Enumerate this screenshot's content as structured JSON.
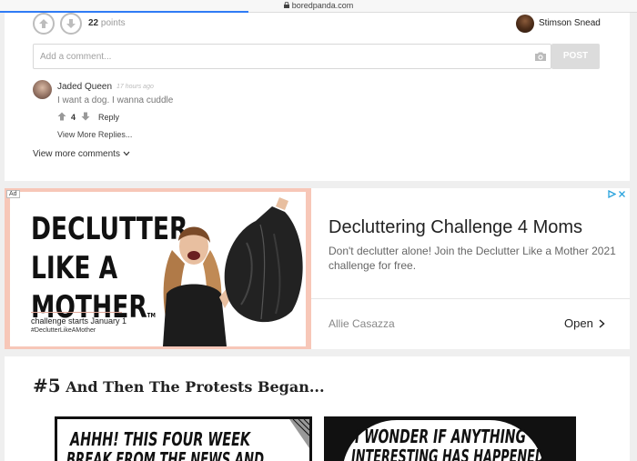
{
  "browser": {
    "url": "boredpanda.com",
    "progress": 0.39
  },
  "post_footer": {
    "points_value": "22",
    "points_label": "points",
    "author_name": "Stimson Snead"
  },
  "comment_form": {
    "placeholder": "Add a comment...",
    "post_label": "POST"
  },
  "comment": {
    "author": "Jaded Queen",
    "time": "17 hours ago",
    "text": "I want a dog. I wanna cuddle",
    "votes": "4",
    "reply_label": "Reply",
    "view_replies_label": "View More Replies..."
  },
  "view_more_comments": "View more comments",
  "ad": {
    "tag": "Ad",
    "banner_line1": "DECLUTTER",
    "banner_line2": "LIKE A",
    "banner_line3": "MOTHER",
    "banner_tm": "TM",
    "banner_sub1": "challenge starts January 1",
    "banner_sub2": "#DeclutterLikeAMother",
    "title": "Decluttering Challenge 4 Moms",
    "description": "Don't declutter alone! Join the Declutter Like a Mother 2021 challenge for free.",
    "advertiser": "Allie Casazza",
    "cta": "Open"
  },
  "article": {
    "number": "#5",
    "title": "And Then The Protests Began...",
    "comic1_line1": "AHHH! THIS FOUR WEEK",
    "comic1_line2": "BREAK FROM THE NEWS AND",
    "comic2_line1": "I WONDER IF ANYTHING",
    "comic2_line2": "INTERESTING HAS HAPPENED"
  },
  "colors": {
    "accent": "#2f7bf5",
    "ad_border": "#f7c7b8",
    "post_button": "#dcdcdc"
  }
}
